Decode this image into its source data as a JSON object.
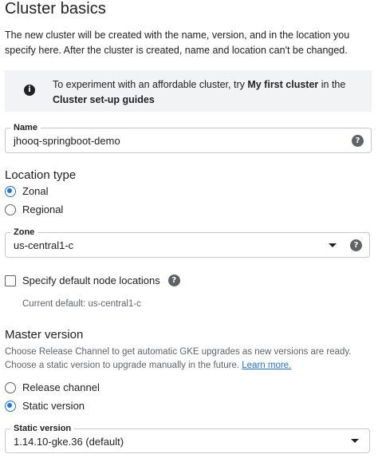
{
  "header": {
    "title": "Cluster basics",
    "description": "The new cluster will be created with the name, version, and in the location you specify here. After the cluster is created, name and location can't be changed."
  },
  "info": {
    "icon": "info-icon",
    "text_before": "To experiment with an affordable cluster, try ",
    "text_bold_1": "My first cluster",
    "text_middle": " in the ",
    "text_bold_2": "Cluster set-up guides"
  },
  "name_field": {
    "label": "Name",
    "value": "jhooq-springboot-demo",
    "help_icon": "help-icon"
  },
  "location_type": {
    "heading": "Location type",
    "options": [
      {
        "label": "Zonal",
        "selected": true
      },
      {
        "label": "Regional",
        "selected": false
      }
    ]
  },
  "zone_field": {
    "label": "Zone",
    "value": "us-central1-c",
    "help_icon": "help-icon"
  },
  "node_locations": {
    "label": "Specify default node locations",
    "checked": false,
    "help_icon": "help-icon",
    "current_default": "Current default: us-central1-c"
  },
  "master_version": {
    "heading": "Master version",
    "description": "Choose Release Channel to get automatic GKE upgrades as new versions are ready. Choose a static version to upgrade manually in the future. ",
    "learn_more": "Learn more.",
    "options": [
      {
        "label": "Release channel",
        "selected": false
      },
      {
        "label": "Static version",
        "selected": true
      }
    ]
  },
  "static_version_field": {
    "label": "Static version",
    "value": "1.14.10-gke.36 (default)"
  },
  "colors": {
    "accent": "#1a73e8",
    "info_bg": "#f1f3f4",
    "muted_text": "#5f6368"
  }
}
